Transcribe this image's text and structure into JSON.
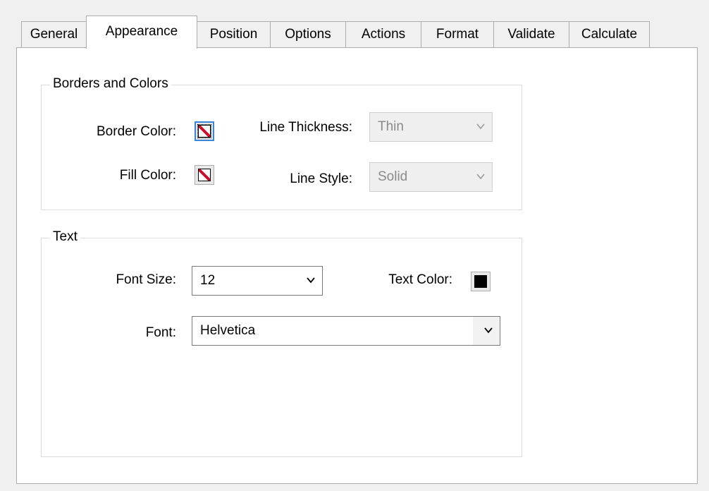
{
  "tabs": [
    {
      "label": "General"
    },
    {
      "label": "Appearance"
    },
    {
      "label": "Position"
    },
    {
      "label": "Options"
    },
    {
      "label": "Actions"
    },
    {
      "label": "Format"
    },
    {
      "label": "Validate"
    },
    {
      "label": "Calculate"
    }
  ],
  "active_tab": "Appearance",
  "borders_and_colors": {
    "title": "Borders and Colors",
    "border_color_label": "Border Color:",
    "fill_color_label": "Fill Color:",
    "line_thickness_label": "Line Thickness:",
    "line_thickness_value": "Thin",
    "line_style_label": "Line Style:",
    "line_style_value": "Solid"
  },
  "text_group": {
    "title": "Text",
    "font_size_label": "Font Size:",
    "font_size_value": "12",
    "text_color_label": "Text Color:",
    "text_color": "#000000",
    "font_label": "Font:",
    "font_value": "Helvetica"
  },
  "icons": {
    "border_color": "no-color-swatch-icon",
    "fill_color": "no-color-swatch-icon",
    "dropdown": "chevron-down-icon"
  }
}
